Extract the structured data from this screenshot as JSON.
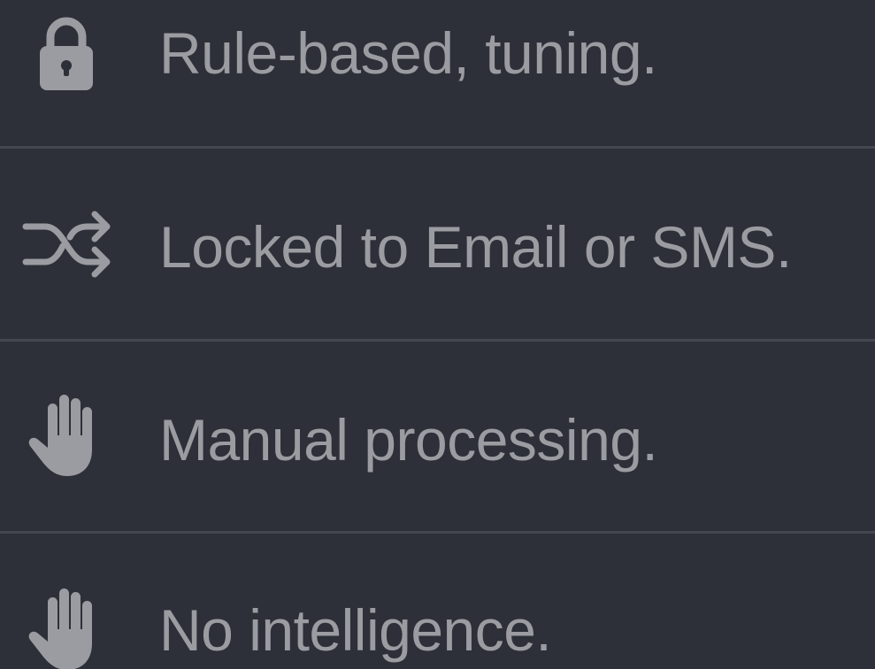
{
  "features": [
    {
      "icon": "lock-icon",
      "label": "Rule-based, tuning."
    },
    {
      "icon": "shuffle-icon",
      "label": "Locked to Email or SMS."
    },
    {
      "icon": "hand-icon",
      "label": "Manual processing."
    },
    {
      "icon": "hand-icon",
      "label": "No intelligence."
    }
  ],
  "colors": {
    "background": "#2d3038",
    "text": "#9a9ca1",
    "divider": "#43474f"
  }
}
